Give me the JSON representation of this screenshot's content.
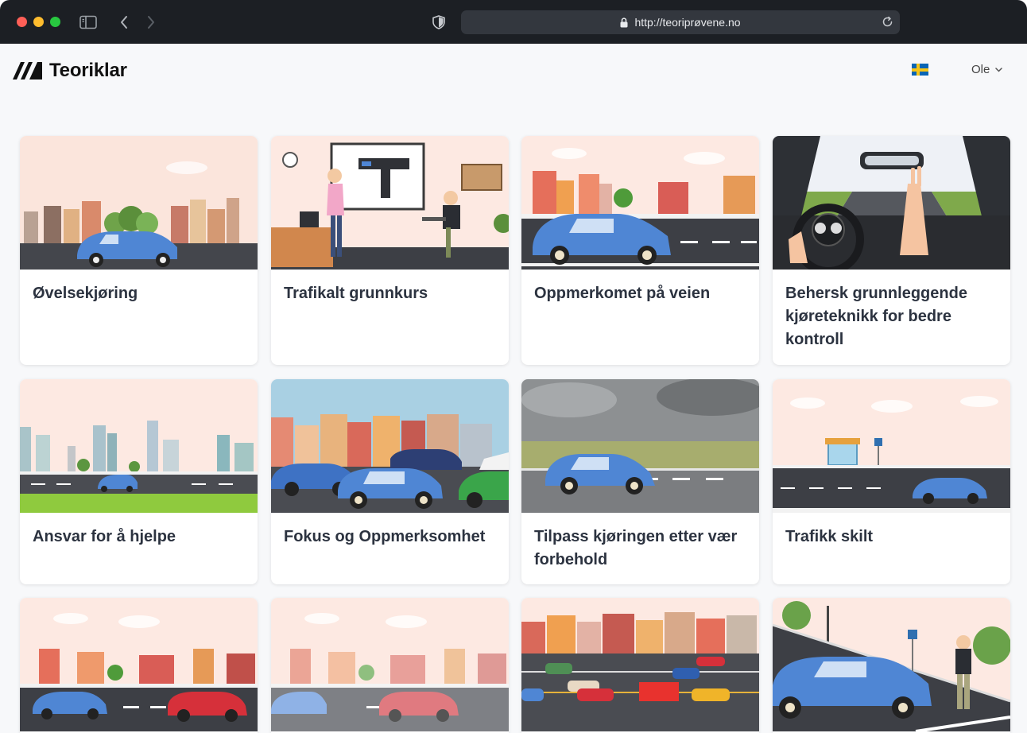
{
  "browser": {
    "url": "http://teoriprøvene.no"
  },
  "app": {
    "brand": "Teoriklar",
    "user_name": "Ole",
    "language_flag": "swedish-flag"
  },
  "courses": [
    {
      "title": "Øvelsekjøring",
      "scene": "city-car"
    },
    {
      "title": "Trafikalt grunnkurs",
      "scene": "classroom"
    },
    {
      "title": "Oppmerkomet på veien",
      "scene": "street-car"
    },
    {
      "title": "Behersk grunnleggende kjøreteknikk for bedre kontroll",
      "scene": "dashboard"
    },
    {
      "title": "Ansvar for å hjelpe",
      "scene": "skyline-road"
    },
    {
      "title": "Fokus og Oppmerksomhet",
      "scene": "traffic-jam"
    },
    {
      "title": "Tilpass kjøringen etter vær forbehold",
      "scene": "rain-road"
    },
    {
      "title": "Trafikk skilt",
      "scene": "bus-stop"
    },
    {
      "title": "",
      "scene": "street-two-cars"
    },
    {
      "title": "",
      "scene": "street-two-cars-faded"
    },
    {
      "title": "",
      "scene": "busy-highway"
    },
    {
      "title": "",
      "scene": "parking"
    }
  ],
  "colors": {
    "card_title": "#2c3340",
    "car_blue": "#4f86d4",
    "road": "#3d3f45",
    "sky": "#fbe5dc"
  }
}
